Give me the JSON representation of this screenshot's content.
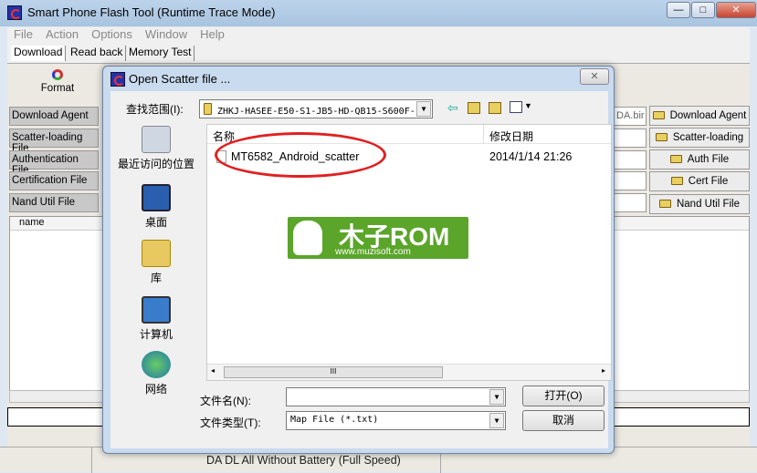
{
  "window": {
    "title": "Smart Phone Flash Tool (Runtime Trace Mode)",
    "min": "—",
    "max": "□",
    "close": "✕"
  },
  "menu": [
    "File",
    "Action",
    "Options",
    "Window",
    "Help"
  ],
  "tabs": [
    "Download",
    "Read back",
    "Memory Test"
  ],
  "toolbar": {
    "format": "Format"
  },
  "left_labels": [
    "Download Agent",
    "Scatter-loading File",
    "Authentication File",
    "Certification File",
    "Nand Util File"
  ],
  "fields": [
    "DA.bir",
    "",
    "",
    "",
    ""
  ],
  "right_buttons": [
    "Download Agent",
    "Scatter-loading",
    "Auth File",
    "Cert File",
    "Nand Util File"
  ],
  "list": {
    "column": "name"
  },
  "status": {
    "mode": "DA DL All Without Battery (Full Speed)"
  },
  "dialog": {
    "title": "Open Scatter file ...",
    "close": "✕",
    "look_in_label": "查找范围(I):",
    "look_in_value": "ZHKJ-HASEE-E50-S1-JB5-HD-QB15-S600F-",
    "places": [
      "最近访问的位置",
      "桌面",
      "库",
      "计算机",
      "网络"
    ],
    "columns": [
      "名称",
      "修改日期"
    ],
    "files": [
      {
        "name": "MT6582_Android_scatter",
        "modified": "2014/1/14 21:26"
      }
    ],
    "filename_label": "文件名(N):",
    "filename_value": "",
    "filetype_label": "文件类型(T):",
    "filetype_value": "Map File (*.txt)",
    "open_button": "打开(O)",
    "cancel_button": "取消",
    "scroll_grip": "III"
  },
  "watermark": {
    "text": "木子ROM",
    "url": "www.muzisoft.com",
    "color": "#5aa52a"
  },
  "annotation_color": "#e02020"
}
